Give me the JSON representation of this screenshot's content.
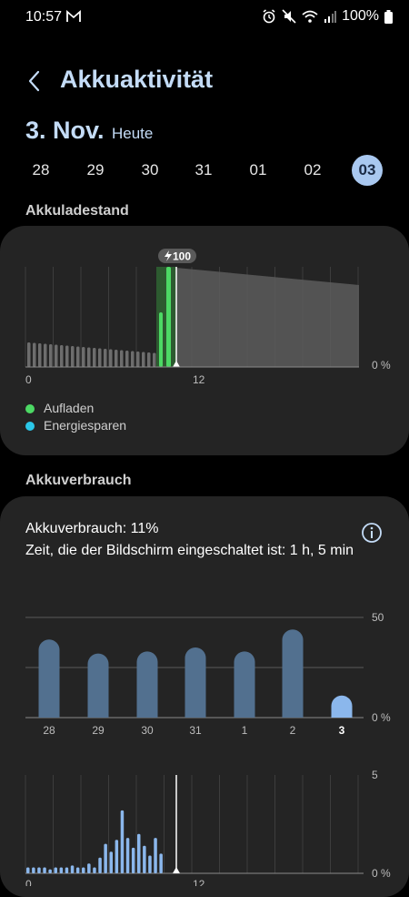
{
  "status_bar": {
    "time": "10:57",
    "battery_percent": "100%"
  },
  "header": {
    "title": "Akkuaktivität"
  },
  "date": {
    "day_label": "3. Nov.",
    "relative": "Heute"
  },
  "days": [
    {
      "label": "28",
      "selected": false
    },
    {
      "label": "29",
      "selected": false
    },
    {
      "label": "30",
      "selected": false
    },
    {
      "label": "31",
      "selected": false
    },
    {
      "label": "01",
      "selected": false
    },
    {
      "label": "02",
      "selected": false
    },
    {
      "label": "03",
      "selected": true
    }
  ],
  "battery_level": {
    "section_label": "Akkuladestand",
    "charge_badge": "100",
    "x_ticks": [
      "0",
      "12"
    ],
    "y_label": "0 %",
    "legend": [
      {
        "label": "Aufladen",
        "color": "#4cd964"
      },
      {
        "label": "Energiesparen",
        "color": "#2bc7e8"
      }
    ]
  },
  "usage": {
    "section_label": "Akkuverbrauch",
    "usage_text": "Akkuverbrauch: 11%",
    "screen_time_text": "Zeit, die der Bildschirm eingeschaltet ist: 1 h, 5 min"
  },
  "chart_data": [
    {
      "type": "bar",
      "title": "",
      "categories": [
        "28",
        "29",
        "30",
        "31",
        "1",
        "2",
        "3"
      ],
      "values": [
        39,
        32,
        33,
        35,
        33,
        44,
        11
      ],
      "ylim": [
        0,
        50
      ],
      "y_tick_labels": [
        "50",
        "0 %"
      ],
      "highlight_category": "3",
      "colors": {
        "bar": "#52708f",
        "selected": "#8bb7ec"
      }
    },
    {
      "type": "bar",
      "title": "",
      "x_tick_labels": [
        "0",
        "12"
      ],
      "y_tick_labels": [
        "5",
        "0 %"
      ],
      "ylim": [
        0,
        5
      ],
      "values": [
        0.3,
        0.3,
        0.3,
        0.3,
        0.2,
        0.3,
        0.3,
        0.3,
        0.4,
        0.3,
        0.3,
        0.5,
        0.3,
        0.8,
        1.5,
        1.1,
        1.7,
        3.2,
        1.8,
        1.3,
        2.0,
        1.4,
        0.9,
        1.8,
        1.0
      ],
      "colors": {
        "bar": "#8bb7ec"
      }
    }
  ]
}
